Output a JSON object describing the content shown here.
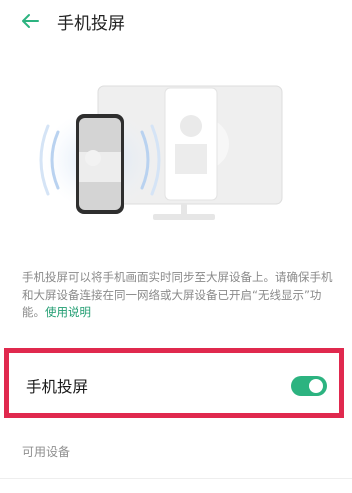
{
  "header": {
    "title": "手机投屏",
    "back_icon": "arrow-left-icon",
    "accent_color": "#2cb380"
  },
  "illustration": {
    "icon": "phone-to-monitor-cast-illustration"
  },
  "description": {
    "text": "手机投屏可以将手机画面实时同步至大屏设备上。请确保手机和大屏设备连接在同一网络或大屏设备已开启“无线显示”功能。",
    "help_link": "使用说明"
  },
  "setting": {
    "label": "手机投屏",
    "enabled": true
  },
  "devices": {
    "section_label": "可用设备"
  }
}
